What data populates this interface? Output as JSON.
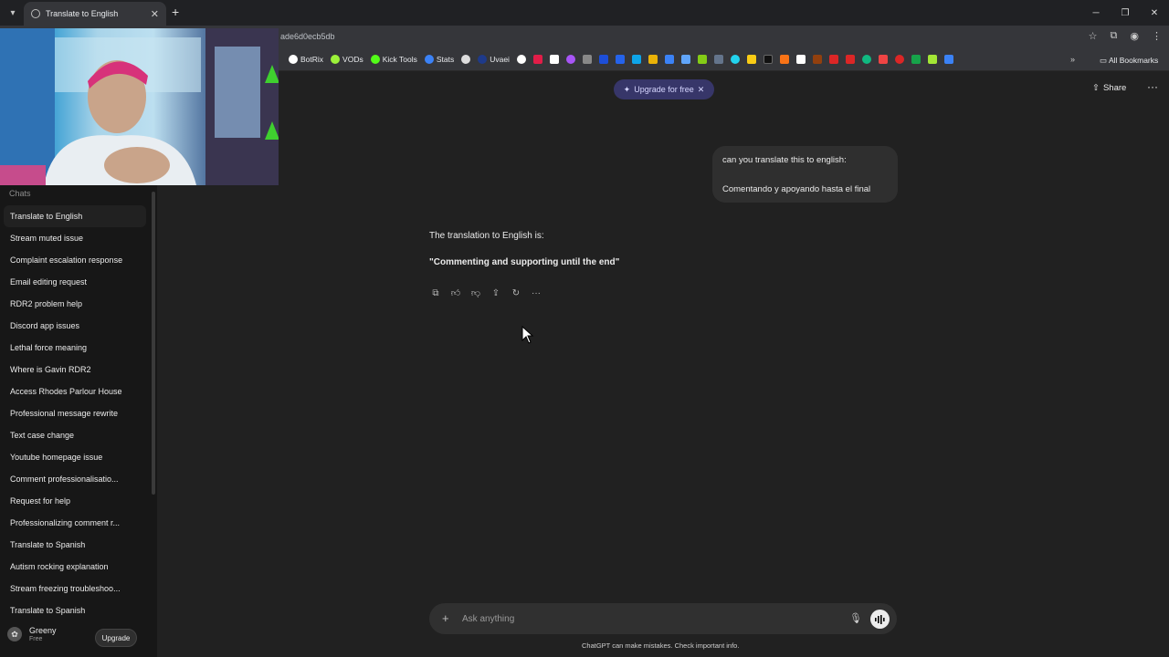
{
  "browser": {
    "tab_title": "Translate to English",
    "url": "ade6d0ecb5db",
    "bookmarks": [
      "BotRix",
      "VODs",
      "Kick Tools",
      "Stats",
      "Uvaei"
    ],
    "all_bookmarks": "All Bookmarks"
  },
  "sidebar": {
    "section_title": "Chats",
    "chats": [
      "Translate to English",
      "Stream muted issue",
      "Complaint escalation response",
      "Email editing request",
      "RDR2 problem help",
      "Discord app issues",
      "Lethal force meaning",
      "Where is Gavin RDR2",
      "Access Rhodes Parlour House",
      "Professional message rewrite",
      "Text case change",
      "Youtube homepage issue",
      "Comment professionalisatio...",
      "Request for help",
      "Professionalizing comment r...",
      "Translate to Spanish",
      "Autism rocking explanation",
      "Stream freezing troubleshoo...",
      "Translate to Spanish"
    ],
    "user": {
      "name": "Greeny",
      "plan": "Free",
      "upgrade_label": "Upgrade"
    }
  },
  "header": {
    "upgrade_pill": "Upgrade for free",
    "share_label": "Share"
  },
  "conversation": {
    "user_message_line1": "can you translate this to english:",
    "user_message_line2": "Comentando y apoyando hasta el final",
    "assistant_intro": "The translation to English is:",
    "assistant_translation": "\"Commenting and supporting until the end\""
  },
  "composer": {
    "placeholder": "Ask anything",
    "disclaimer": "ChatGPT can make mistakes. Check important info."
  }
}
